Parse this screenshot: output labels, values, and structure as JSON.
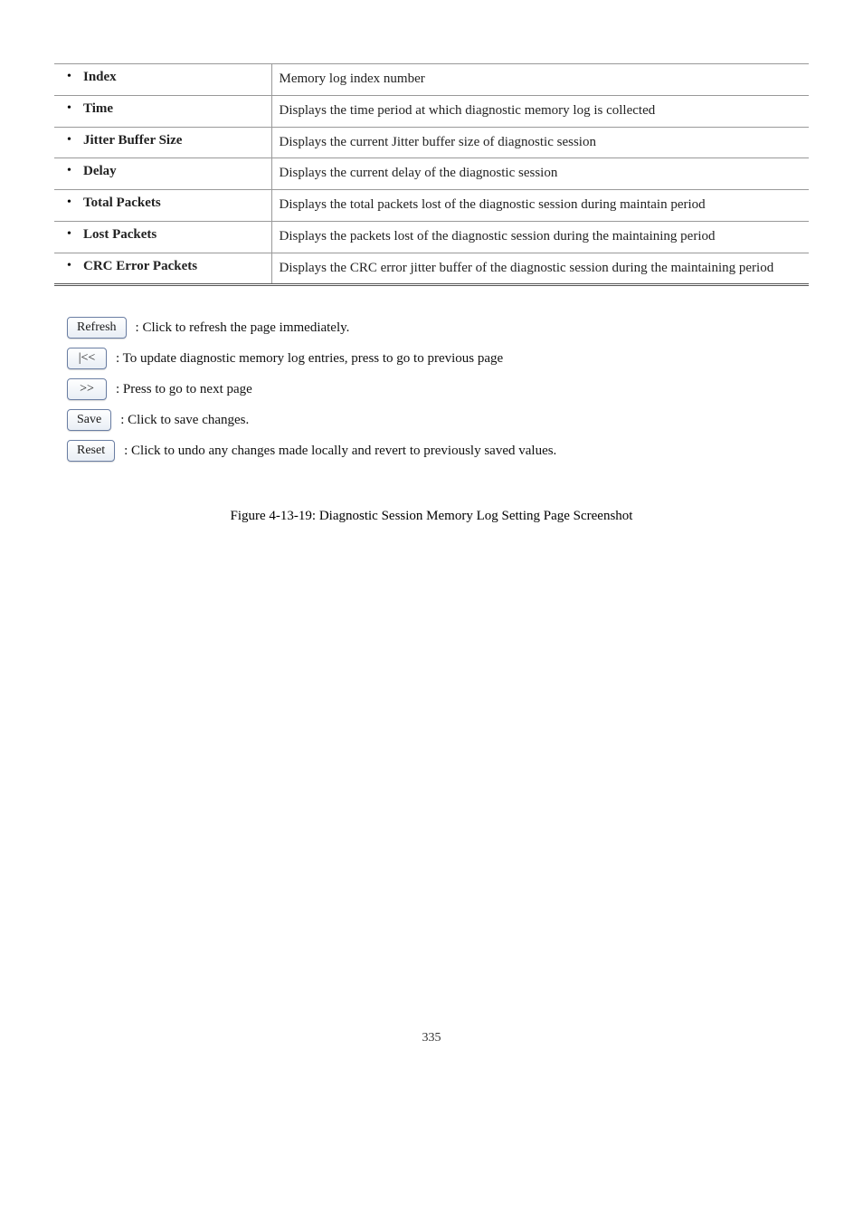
{
  "table": {
    "rows": [
      {
        "term": "Index",
        "desc": "Memory log index number"
      },
      {
        "term": "Time",
        "desc": "Displays the time period at which diagnostic memory log is collected"
      },
      {
        "term": "Jitter Buffer Size",
        "desc": "Displays the current Jitter buffer size of diagnostic session"
      },
      {
        "term": "Delay",
        "desc": "Displays the current delay of the diagnostic session"
      },
      {
        "term": "Total Packets",
        "desc": "Displays the total packets lost of the diagnostic session during maintain period"
      },
      {
        "term": "Lost Packets",
        "desc": "Displays the packets lost of the diagnostic session during the maintaining period"
      },
      {
        "term": "CRC Error Packets",
        "desc": "Displays the CRC error jitter buffer of the diagnostic session during the maintaining period"
      }
    ]
  },
  "buttons": {
    "refresh": {
      "label": "Refresh",
      "caption": ": Click to refresh the page immediately."
    },
    "prev": {
      "label": "|<<",
      "caption": ": To update diagnostic memory log entries, press to go to previous page"
    },
    "next": {
      "label": ">>",
      "caption": ": Press to go to next page"
    },
    "save": {
      "label": "Save",
      "caption": ": Click to save changes."
    },
    "reset": {
      "label": "Reset",
      "caption": ": Click to undo any changes made locally and revert to previously saved values."
    }
  },
  "figure_caption": "Figure 4-13-19: Diagnostic Session Memory Log Setting Page Screenshot",
  "page_number": "335"
}
